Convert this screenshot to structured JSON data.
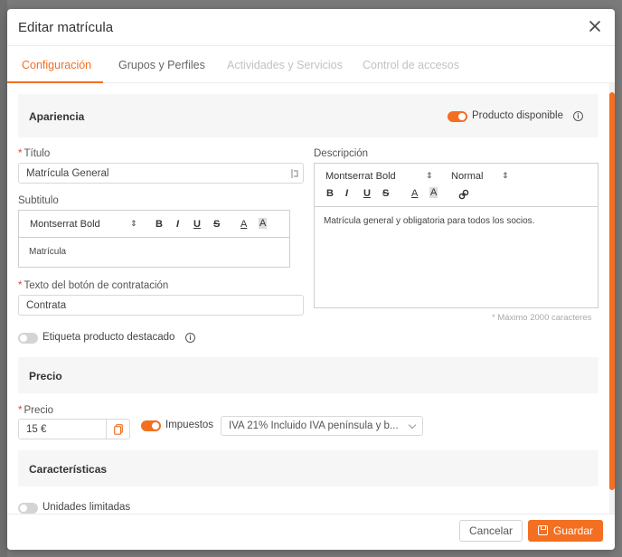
{
  "modal": {
    "title": "Editar matrícula"
  },
  "tabs": [
    {
      "label": "Configuración",
      "state": "active"
    },
    {
      "label": "Grupos y Perfiles",
      "state": "normal"
    },
    {
      "label": "Actividades y Servicios",
      "state": "disabled"
    },
    {
      "label": "Control de accesos",
      "state": "disabled"
    }
  ],
  "apariencia": {
    "section_title": "Apariencia",
    "producto_disponible_label": "Producto disponible",
    "producto_disponible_on": true
  },
  "titulo": {
    "label": "Título",
    "required_mark": "*",
    "value": "Matrícula General"
  },
  "subtitulo": {
    "label": "Subtitulo",
    "font": "Montserrat Bold",
    "toolbar": [
      "B",
      "I",
      "U",
      "S",
      "A",
      "A"
    ],
    "content": "Matrícula"
  },
  "descripcion": {
    "label": "Descripción",
    "font": "Montserrat Bold",
    "size": "Normal",
    "toolbar": [
      "B",
      "I",
      "U",
      "S",
      "A",
      "A"
    ],
    "content": "Matrícula general y obligatoria para todos los socios.",
    "hint": "* Máximo 2000 caracteres"
  },
  "boton_contratacion": {
    "label": "Texto del botón de contratación",
    "required_mark": "*",
    "value": "Contrata"
  },
  "etiqueta_destacado": {
    "label": "Etiqueta producto destacado",
    "on": false
  },
  "precio_section": {
    "section_title": "Precio"
  },
  "precio": {
    "label": "Precio",
    "required_mark": "*",
    "value": "15 €",
    "impuestos_label": "Impuestos",
    "impuestos_on": true,
    "impuestos_value": "IVA 21% Incluido IVA península y b..."
  },
  "caracteristicas": {
    "section_title": "Características",
    "unidades_limitadas_label": "Unidades limitadas",
    "unidades_limitadas_on": false
  },
  "footer": {
    "cancel_label": "Cancelar",
    "save_label": "Guardar"
  },
  "colors": {
    "accent": "#f36f21",
    "section_bg": "#f6f6f6",
    "required": "#e54040"
  }
}
